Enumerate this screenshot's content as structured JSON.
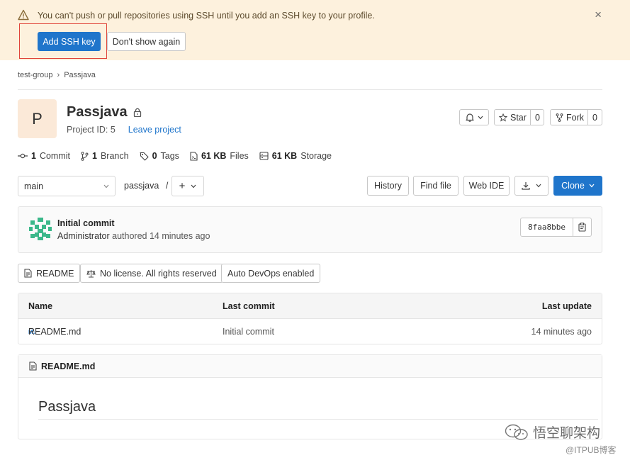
{
  "banner": {
    "message": "You can't push or pull repositories using SSH until you add an SSH key to your profile.",
    "add_key_label": "Add SSH key",
    "dont_show_label": "Don't show again",
    "close_glyph": "×"
  },
  "breadcrumb": {
    "group": "test-group",
    "separator": "›",
    "project": "Passjava"
  },
  "project": {
    "avatar_letter": "P",
    "name": "Passjava",
    "id_label": "Project ID: 5",
    "leave_label": "Leave project",
    "star_label": "Star",
    "star_count": "0",
    "fork_label": "Fork",
    "fork_count": "0"
  },
  "stats": {
    "commits_num": "1",
    "commits_label": "Commit",
    "branches_num": "1",
    "branches_label": "Branch",
    "tags_num": "0",
    "tags_label": "Tags",
    "files_size": "61 KB",
    "files_label": "Files",
    "storage_size": "61 KB",
    "storage_label": "Storage"
  },
  "controls": {
    "branch": "main",
    "path": "passjava",
    "path_sep": "/",
    "add_glyph": "+",
    "history": "History",
    "find_file": "Find file",
    "web_ide": "Web IDE",
    "clone": "Clone"
  },
  "commit": {
    "title": "Initial commit",
    "author": "Administrator",
    "meta": "authored 14 minutes ago",
    "sha": "8faa8bbe"
  },
  "badges": {
    "readme": "README",
    "license": "No license. All rights reserved",
    "devops": "Auto DevOps enabled"
  },
  "table": {
    "headers": {
      "name": "Name",
      "last_commit": "Last commit",
      "last_update": "Last update"
    },
    "rows": [
      {
        "icon": "M↓",
        "name": "README.md",
        "last_commit": "Initial commit",
        "last_update": "14 minutes ago"
      }
    ]
  },
  "readme": {
    "filename": "README.md",
    "heading": "Passjava"
  },
  "watermark": {
    "line1": "悟空聊架构",
    "line2": "@ITPUB博客"
  },
  "colors": {
    "primary": "#1f75cb",
    "banner_bg": "#fdf1dd",
    "highlight": "#e0443a"
  }
}
